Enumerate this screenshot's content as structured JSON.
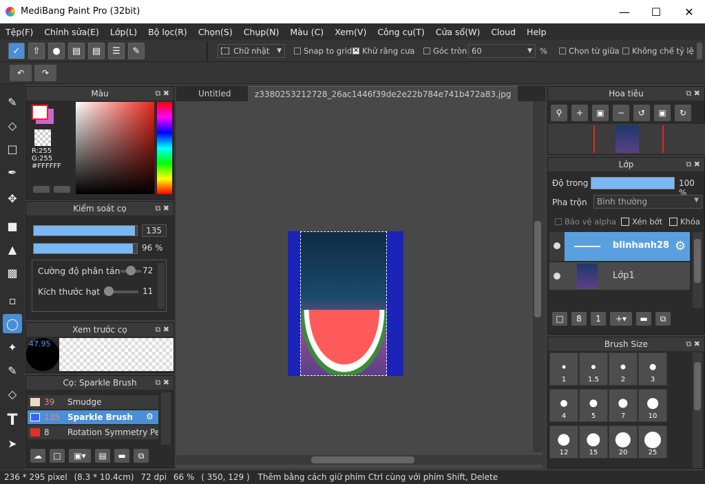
{
  "window": {
    "title": "MediBang Paint Pro (32bit)"
  },
  "menu": [
    "Tệp(F)",
    "Chỉnh sửa(E)",
    "Lớp(L)",
    "Bộ lọc(R)",
    "Chọn(S)",
    "Chụp(N)",
    "Màu (C)",
    "Xem(V)",
    "Công cụ(T)",
    "Cửa sổ(W)",
    "Cloud",
    "Help"
  ],
  "toolbar": {
    "shape_select": "Chữ nhật",
    "snap_label": "Snap to grid",
    "antialias_label": "Khử răng cưa",
    "corner_label": "Góc tròn",
    "corner_value": "60",
    "percent": "%",
    "center_label": "Chọn từ giữa",
    "ratio_label": "Không chế tỷ lệ"
  },
  "color_panel": {
    "title": "Màu",
    "r": "R:255",
    "g": "G:255",
    "b": "B:255",
    "hex": "#FFFFFF",
    "primary_color": "#ffffff",
    "secondary_color": "#cc66cc"
  },
  "brush_control": {
    "title": "Kiểm soát cọ",
    "size_value": "135",
    "size_fraction": 0.98,
    "opacity_value": "96 %",
    "opacity_fraction": 0.96,
    "scatter_label": "Cường độ phân tán",
    "scatter_value": "72",
    "particle_label": "Kích thước hạt",
    "particle_value": "11"
  },
  "brush_preview": {
    "title": "Xem trước cọ",
    "size_readout": "47.95"
  },
  "brush_list": {
    "title": "Cọ: Sparkle Brush",
    "items": [
      {
        "num": "39",
        "name": "Smudge",
        "color": "#f0d8c8"
      },
      {
        "num": "135",
        "name": "Sparkle Brush",
        "color": "#3366ff"
      },
      {
        "num": "8",
        "name": "Rotation Symmetry Pe",
        "color": "#e03030"
      }
    ]
  },
  "tabs": [
    "Untitled",
    "z3380253212728_26ac1446f39de2e22b784e741b472a83.jpg"
  ],
  "navigator": {
    "title": "Hoa tiêu"
  },
  "layers": {
    "title": "Lớp",
    "opacity_label": "Độ trong",
    "opacity_value": "100 %",
    "opacity_fraction": 1.0,
    "blend_label": "Pha trộn",
    "blend_value": "Bình thường",
    "protect_alpha": "Bảo vệ alpha",
    "clip": "Xén bớt",
    "lock": "Khóa",
    "items": [
      {
        "name": "blinhanh28"
      },
      {
        "name": "Lớp1"
      }
    ]
  },
  "brush_size": {
    "title": "Brush Size",
    "sizes": [
      "1",
      "1.5",
      "2",
      "3",
      "4",
      "5",
      "7",
      "10",
      "12",
      "15",
      "20",
      "25"
    ]
  },
  "status": {
    "dims": "236 * 295 pixel",
    "cm": "(8.3 * 10.4cm)",
    "dpi": "72 dpi",
    "zoom": "66 %",
    "coords": "( 350, 129 )",
    "hint": "Thêm bằng cách giữ phím Ctrl cùng với phím Shift, Delete"
  }
}
